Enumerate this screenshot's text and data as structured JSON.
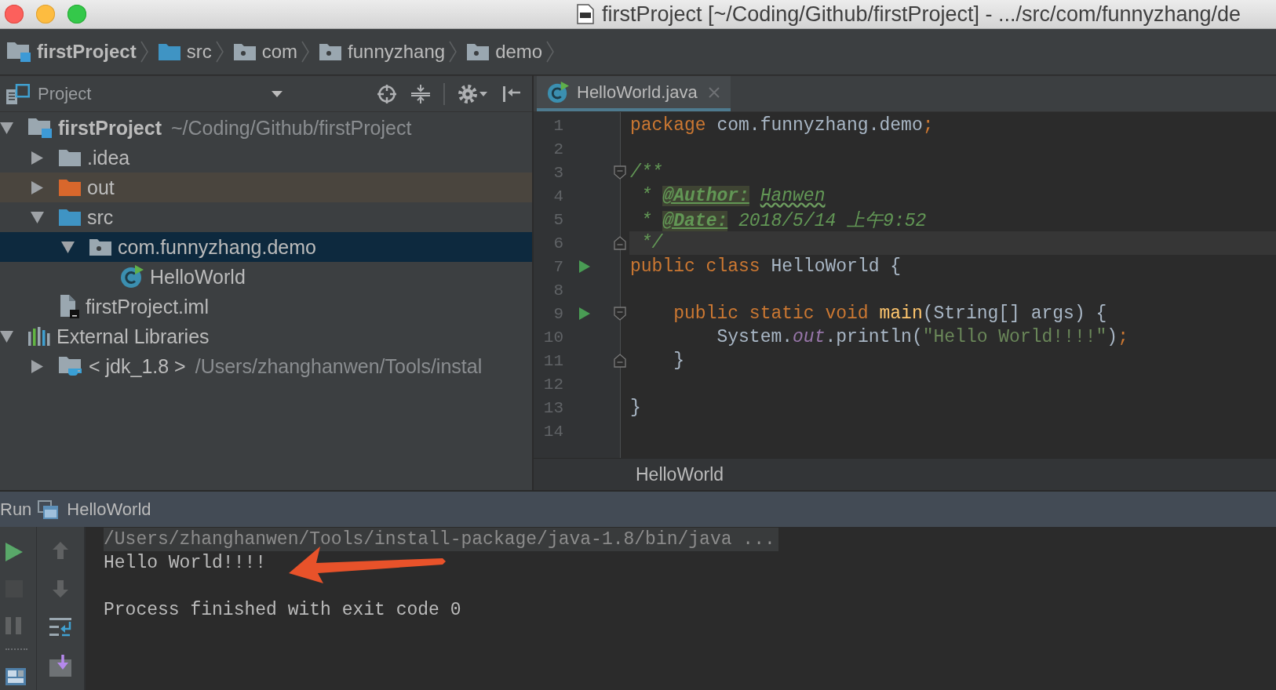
{
  "window": {
    "title": "firstProject [~/Coding/Github/firstProject] - .../src/com/funnyzhang/de"
  },
  "navigation_bar": [
    {
      "label": "firstProject",
      "kind": "project"
    },
    {
      "label": "src",
      "kind": "source-folder"
    },
    {
      "label": "com",
      "kind": "package"
    },
    {
      "label": "funnyzhang",
      "kind": "package"
    },
    {
      "label": "demo",
      "kind": "package"
    }
  ],
  "project_panel": {
    "title": "Project",
    "tree": [
      {
        "label": "firstProject",
        "path": "~/Coding/Github/firstProject",
        "kind": "project",
        "expanded": true,
        "selected": false,
        "children": [
          {
            "label": ".idea",
            "kind": "folder",
            "expanded": false,
            "selected": false
          },
          {
            "label": "out",
            "kind": "excluded-folder",
            "expanded": false,
            "selected": false
          },
          {
            "label": "src",
            "kind": "source-folder",
            "expanded": true,
            "selected": false,
            "children": [
              {
                "label": "com.funnyzhang.demo",
                "kind": "package",
                "expanded": true,
                "selected": true,
                "children": [
                  {
                    "label": "HelloWorld",
                    "kind": "class",
                    "selected": false
                  }
                ]
              }
            ]
          },
          {
            "label": "firstProject.iml",
            "kind": "module-file",
            "selected": false
          }
        ]
      },
      {
        "label": "External Libraries",
        "kind": "libraries",
        "expanded": true,
        "selected": false,
        "children": [
          {
            "label": "< jdk_1.8 >",
            "path": "/Users/zhanghanwen/Tools/instal",
            "kind": "jdk",
            "expanded": false,
            "selected": false
          }
        ]
      }
    ]
  },
  "editor": {
    "tabs": [
      {
        "label": "HelloWorld.java",
        "selected": true
      }
    ],
    "lines": [
      {
        "number": "1",
        "tokens": [
          {
            "text": "package",
            "kind": "keyword"
          },
          {
            "text": " com.funnyzhang.demo",
            "kind": "plain"
          },
          {
            "text": ";",
            "kind": "keyword"
          }
        ]
      },
      {
        "number": "2"
      },
      {
        "number": "3",
        "fold_start": true,
        "tokens": [
          {
            "text": "/**",
            "kind": "doc"
          }
        ]
      },
      {
        "number": "4",
        "tokens": [
          {
            "text": " * ",
            "kind": "doc"
          },
          {
            "text": "@Author:",
            "kind": "doc-tag"
          },
          {
            "text": " Hanwen",
            "kind": "doc-typo"
          }
        ]
      },
      {
        "number": "5",
        "tokens": [
          {
            "text": " * ",
            "kind": "doc"
          },
          {
            "text": "@Date:",
            "kind": "doc-tag"
          },
          {
            "text": " 2018/5/14 上午9:52",
            "kind": "doc"
          }
        ]
      },
      {
        "number": "6",
        "current": true,
        "fold_end": true,
        "tokens": [
          {
            "text": " */",
            "kind": "doc"
          }
        ]
      },
      {
        "number": "7",
        "run": true,
        "tokens": [
          {
            "text": "public class",
            "kind": "keyword"
          },
          {
            "text": " HelloWorld {",
            "kind": "plain"
          }
        ]
      },
      {
        "number": "8"
      },
      {
        "number": "9",
        "run": true,
        "fold_start": true,
        "tokens": [
          {
            "text": "    public static void ",
            "kind": "keyword"
          },
          {
            "text": "main",
            "kind": "method"
          },
          {
            "text": "(String[] args) {",
            "kind": "plain"
          }
        ]
      },
      {
        "number": "10",
        "tokens": [
          {
            "text": "        System.",
            "kind": "plain"
          },
          {
            "text": "out",
            "kind": "static-field"
          },
          {
            "text": ".println(",
            "kind": "plain"
          },
          {
            "text": "\"Hello World!!!!\"",
            "kind": "string"
          },
          {
            "text": ")",
            "kind": "plain"
          },
          {
            "text": ";",
            "kind": "keyword"
          }
        ]
      },
      {
        "number": "11",
        "fold_end": true,
        "tokens": [
          {
            "text": "    }",
            "kind": "plain"
          }
        ]
      },
      {
        "number": "12"
      },
      {
        "number": "13",
        "tokens": [
          {
            "text": "}",
            "kind": "plain"
          }
        ]
      },
      {
        "number": "14"
      }
    ],
    "breadcrumb": "HelloWorld"
  },
  "run_panel": {
    "title": "Run",
    "configuration": "HelloWorld",
    "toolbars": [
      {
        "buttons": [
          {
            "kind": "run",
            "disabled": false
          },
          {
            "kind": "stop",
            "disabled": true
          },
          {
            "kind": "pause",
            "disabled": true
          },
          {
            "kind": "separator"
          },
          {
            "kind": "layout",
            "disabled": false
          }
        ]
      },
      {
        "buttons": [
          {
            "kind": "up",
            "disabled": true
          },
          {
            "kind": "down",
            "disabled": true
          },
          {
            "kind": "soft-wrap",
            "disabled": false
          },
          {
            "kind": "scroll-to-end",
            "disabled": false
          }
        ]
      }
    ],
    "console": {
      "command": "/Users/zhanghanwen/Tools/install-package/java-1.8/bin/java ...",
      "output": [
        "Hello World!!!!"
      ],
      "exit_message": "Process finished with exit code 0"
    }
  }
}
